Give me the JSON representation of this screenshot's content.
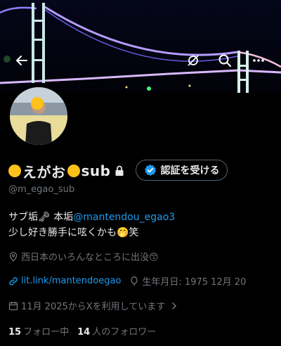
{
  "profile": {
    "name_parts": [
      "😊",
      "えがお",
      "😊",
      "sub"
    ],
    "handle": "@m_egao_sub",
    "verify_label": "認証を受ける",
    "bio": {
      "line1_prefix": "サブ垢🗝 本垢",
      "line1_link": "@mantendou_egao3",
      "line2_text": "少し好き勝手に呟くかも🤭笑"
    },
    "location": "西日本のいろんなところに出没😙",
    "website": "lit.link/mantendoegao",
    "birthday": "生年月日: 1975 12月 20",
    "joined": "11月 2025からXを利用しています",
    "following_count": "15",
    "following_label": "フォロー中",
    "followers_count": "14",
    "followers_label": "人のフォロワー"
  },
  "icons": {
    "back": "back-arrow-icon",
    "hide": "eye-off-icon",
    "search": "search-icon",
    "more": "more-icon",
    "lock": "lock-icon",
    "verified": "verified-badge-icon",
    "location": "location-pin-icon",
    "link": "link-icon",
    "birthday": "balloon-icon",
    "calendar": "calendar-icon",
    "chevron": "chevron-right-icon"
  },
  "colors": {
    "accent": "#1d9bf0",
    "secondary_text": "#71767b",
    "primary_text": "#e7e9ea",
    "background": "#000000"
  }
}
